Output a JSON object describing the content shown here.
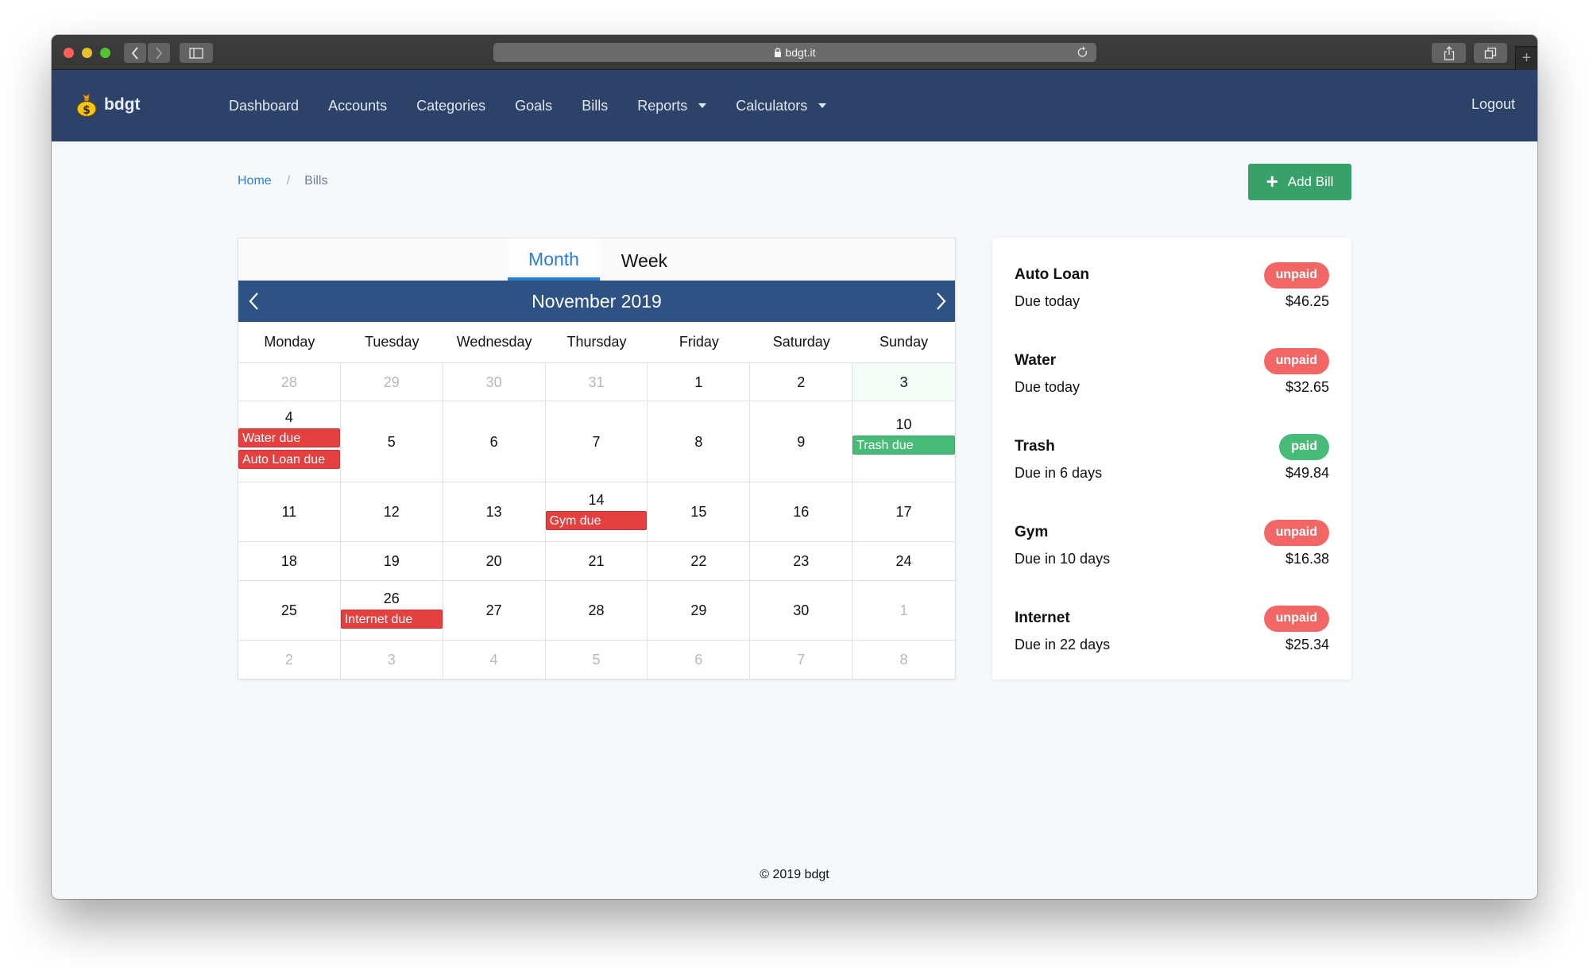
{
  "browser": {
    "url": "bdgt.it"
  },
  "navbar": {
    "brand": "bdgt",
    "items": [
      {
        "label": "Dashboard",
        "dropdown": false
      },
      {
        "label": "Accounts",
        "dropdown": false
      },
      {
        "label": "Categories",
        "dropdown": false
      },
      {
        "label": "Goals",
        "dropdown": false
      },
      {
        "label": "Bills",
        "dropdown": false
      },
      {
        "label": "Reports",
        "dropdown": true
      },
      {
        "label": "Calculators",
        "dropdown": true
      }
    ],
    "logout": "Logout"
  },
  "breadcrumb": {
    "home": "Home",
    "separator": "/",
    "current": "Bills"
  },
  "actions": {
    "add_bill": "Add Bill"
  },
  "calendar": {
    "tabs": {
      "month": "Month",
      "week": "Week",
      "active": "Month"
    },
    "title": "November 2019",
    "weekdays": [
      "Monday",
      "Tuesday",
      "Wednesday",
      "Thursday",
      "Friday",
      "Saturday",
      "Sunday"
    ],
    "weeks": [
      [
        {
          "day": "28",
          "other": true
        },
        {
          "day": "29",
          "other": true
        },
        {
          "day": "30",
          "other": true
        },
        {
          "day": "31",
          "other": true
        },
        {
          "day": "1"
        },
        {
          "day": "2"
        },
        {
          "day": "3",
          "today": true
        }
      ],
      [
        {
          "day": "4",
          "events": [
            {
              "label": "Water due",
              "status": "unpaid"
            },
            {
              "label": "Auto Loan due",
              "status": "unpaid"
            }
          ]
        },
        {
          "day": "5"
        },
        {
          "day": "6"
        },
        {
          "day": "7"
        },
        {
          "day": "8"
        },
        {
          "day": "9"
        },
        {
          "day": "10",
          "events": [
            {
              "label": "Trash due",
              "status": "paid"
            }
          ]
        }
      ],
      [
        {
          "day": "11"
        },
        {
          "day": "12"
        },
        {
          "day": "13"
        },
        {
          "day": "14",
          "events": [
            {
              "label": "Gym due",
              "status": "unpaid"
            }
          ]
        },
        {
          "day": "15"
        },
        {
          "day": "16"
        },
        {
          "day": "17"
        }
      ],
      [
        {
          "day": "18"
        },
        {
          "day": "19"
        },
        {
          "day": "20"
        },
        {
          "day": "21"
        },
        {
          "day": "22"
        },
        {
          "day": "23"
        },
        {
          "day": "24"
        }
      ],
      [
        {
          "day": "25"
        },
        {
          "day": "26",
          "events": [
            {
              "label": "Internet due",
              "status": "unpaid"
            }
          ]
        },
        {
          "day": "27"
        },
        {
          "day": "28"
        },
        {
          "day": "29"
        },
        {
          "day": "30"
        },
        {
          "day": "1",
          "other": true
        }
      ],
      [
        {
          "day": "2",
          "other": true
        },
        {
          "day": "3",
          "other": true
        },
        {
          "day": "4",
          "other": true
        },
        {
          "day": "5",
          "other": true
        },
        {
          "day": "6",
          "other": true
        },
        {
          "day": "7",
          "other": true
        },
        {
          "day": "8",
          "other": true
        }
      ]
    ]
  },
  "bills": [
    {
      "name": "Auto Loan",
      "status": "unpaid",
      "due": "Due today",
      "amount": "$46.25"
    },
    {
      "name": "Water",
      "status": "unpaid",
      "due": "Due today",
      "amount": "$32.65"
    },
    {
      "name": "Trash",
      "status": "paid",
      "due": "Due in 6 days",
      "amount": "$49.84"
    },
    {
      "name": "Gym",
      "status": "unpaid",
      "due": "Due in 10 days",
      "amount": "$16.38"
    },
    {
      "name": "Internet",
      "status": "unpaid",
      "due": "Due in 22 days",
      "amount": "$25.34"
    }
  ],
  "footer": "© 2019 bdgt",
  "colors": {
    "navbar": "#2c4268",
    "calendar_header": "#2e5283",
    "accent_blue": "#2b7fd2",
    "add_button": "#38a169",
    "unpaid": "#f26666",
    "paid": "#48bb78",
    "event_unpaid": "#e3403f",
    "event_paid": "#48bb78"
  }
}
